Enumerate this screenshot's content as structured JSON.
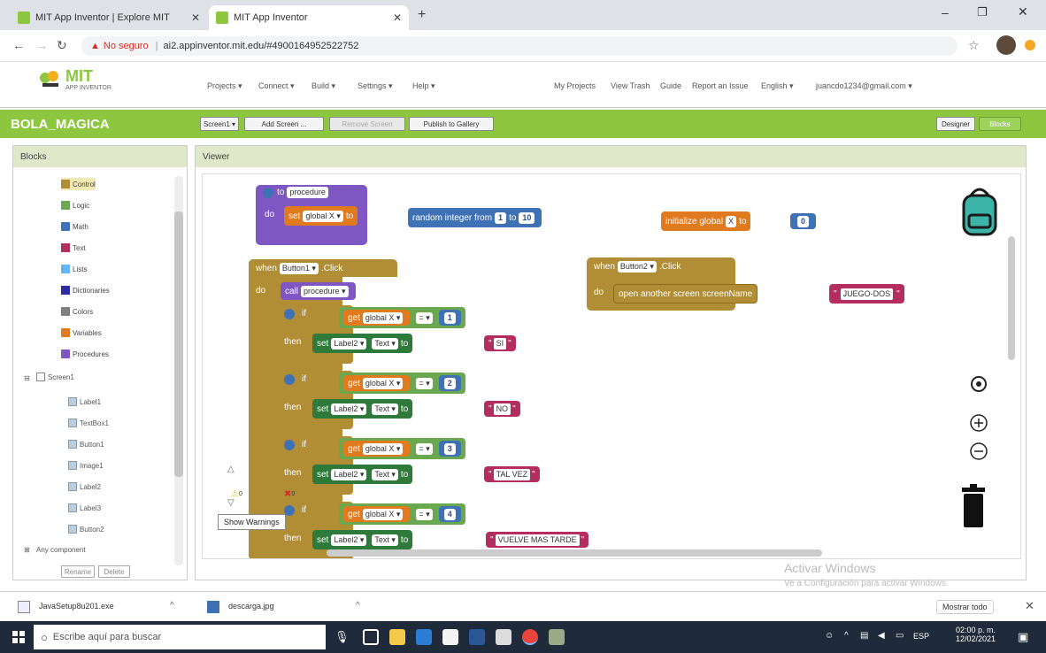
{
  "browser": {
    "tabs": [
      {
        "label": "MIT App Inventor | Explore MIT"
      },
      {
        "label": "MIT App Inventor"
      }
    ],
    "security_label": "No seguro",
    "url": "ai2.appinventor.mit.edu/#4900164952522752"
  },
  "header": {
    "logo_line1": "MIT",
    "logo_line2": "APP INVENTOR",
    "menus": [
      "Projects ▾",
      "Connect ▾",
      "Build ▾",
      "Settings ▾",
      "Help ▾"
    ],
    "links": [
      "My Projects",
      "View Trash",
      "Guide",
      "Report an Issue",
      "English ▾",
      "juancdo1234@gmail.com ▾"
    ]
  },
  "project": {
    "name": "BOLA_MAGICA",
    "screen_dropdown": "Screen1 ▾",
    "add_screen": "Add Screen ...",
    "remove_screen": "Remove Screen",
    "publish": "Publish to Gallery",
    "designer": "Designer",
    "blocks": "Blocks"
  },
  "blocks_panel": {
    "title": "Blocks",
    "builtin": [
      {
        "label": "Control",
        "color": "#b18e35"
      },
      {
        "label": "Logic",
        "color": "#6aa84f"
      },
      {
        "label": "Math",
        "color": "#3f71b5"
      },
      {
        "label": "Text",
        "color": "#b32d5e"
      },
      {
        "label": "Lists",
        "color": "#64b5f6"
      },
      {
        "label": "Dictionaries",
        "color": "#2d2d9f"
      },
      {
        "label": "Colors",
        "color": "#808080"
      },
      {
        "label": "Variables",
        "color": "#e07a1f"
      },
      {
        "label": "Procedures",
        "color": "#7e57c2"
      }
    ],
    "screen_label": "Screen1",
    "components": [
      "Label1",
      "TextBox1",
      "Button1",
      "Image1",
      "Label2",
      "Label3",
      "Button2"
    ],
    "any_component": "Any component",
    "rename": "Rename",
    "delete": "Delete"
  },
  "viewer": {
    "title": "Viewer",
    "show_warnings": "Show Warnings",
    "warn_count": "0",
    "err_count": "0"
  },
  "code": {
    "proc_to": "to",
    "proc_name": "procedure",
    "do": "do",
    "set": "set",
    "global_x": "global X ▾",
    "to": "to",
    "random_from": "random integer from",
    "rand_min": "1",
    "rand_max": "10",
    "init_global": "initialize global",
    "var_name": "X",
    "init_val": "0",
    "when": "when",
    "button1": "Button1 ▾",
    "button2": "Button2 ▾",
    "click": ".Click",
    "call": "call",
    "procedure_dd": "procedure ▾",
    "if": "if",
    "then": "then",
    "get": "get",
    "get_var": "global X ▾",
    "eq": "= ▾",
    "label2": "Label2 ▾",
    "text_prop": "Text ▾",
    "open_screen": "open another screen  screenName",
    "screen_target": "JUEGO-DOS",
    "branches": [
      {
        "num": "1",
        "text": "SI"
      },
      {
        "num": "2",
        "text": "NO"
      },
      {
        "num": "3",
        "text": "TAL VEZ"
      },
      {
        "num": "4",
        "text": "VUELVE MAS TARDE"
      }
    ]
  },
  "watermark": {
    "line1": "Activar Windows",
    "line2": "Ve a Configuración para activar Windows."
  },
  "downloads": {
    "items": [
      "JavaSetup8u201.exe",
      "descarga.jpg"
    ],
    "show_all": "Mostrar todo"
  },
  "taskbar": {
    "search_placeholder": "Escribe aquí para buscar",
    "lang": "ESP",
    "time": "02:00 p. m.",
    "date": "12/02/2021"
  }
}
